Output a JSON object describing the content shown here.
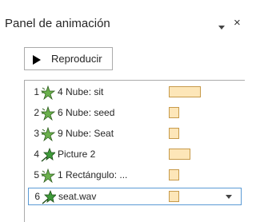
{
  "panel": {
    "title": "Panel de animación",
    "dropdown_icon": "chevron-down-icon",
    "close_label": "×"
  },
  "toolbar": {
    "play_label": "Reproducir",
    "play_icon": "play-icon"
  },
  "animations": [
    {
      "index": "1",
      "label": "4 Nube: sit",
      "icon": "emphasis-effect-icon",
      "timing": "long"
    },
    {
      "index": "2",
      "label": "6 Nube: seed",
      "icon": "emphasis-effect-icon",
      "timing": "short"
    },
    {
      "index": "3",
      "label": "9 Nube: Seat",
      "icon": "emphasis-effect-icon",
      "timing": "short"
    },
    {
      "index": "4",
      "label": "Picture 2",
      "icon": "entrance-effect-icon",
      "timing": "medium"
    },
    {
      "index": "5",
      "label": "1 Rectángulo: ...",
      "icon": "emphasis-effect-icon",
      "timing": "short"
    },
    {
      "index": "6",
      "label": "seat.wav",
      "icon": "entrance-effect-icon",
      "timing": "short",
      "selected": true
    }
  ],
  "colors": {
    "timing_fill": "#fde6b8",
    "timing_border": "#c79a4a",
    "selection_border": "#5b9bd5",
    "emphasis_star": "#6ab04c",
    "entrance_star": "#3f9b3a"
  }
}
